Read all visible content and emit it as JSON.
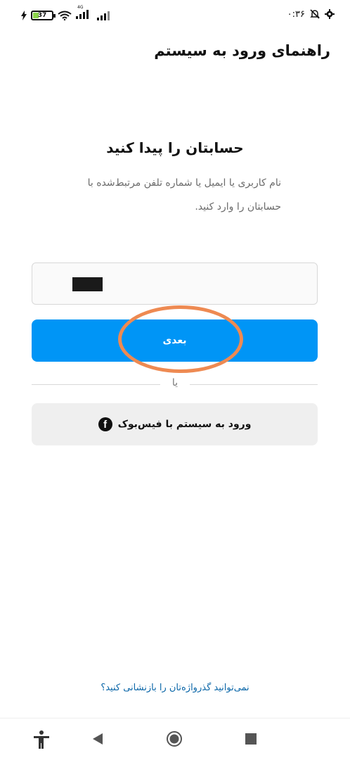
{
  "status_bar": {
    "battery": "37",
    "network": "4G",
    "time": "۰:۳۶"
  },
  "header": {
    "title": "راهنمای ورود به سیستم"
  },
  "main": {
    "heading": "حسابتان را پیدا کنید",
    "subtitle": "نام کاربری یا ایمیل یا شماره تلفن مرتبط‌شده با حسابتان را وارد کنید.",
    "next_label": "بعدی",
    "or_label": "یا",
    "facebook_label": "ورود به سیستم با فیس‌بوک"
  },
  "footer": {
    "forgot_link": "نمی‌توانید گذرواژه‌تان را بازنشانی کنید؟"
  },
  "colors": {
    "primary_button": "#0095f6",
    "highlight_ring": "#ee8a52",
    "link": "#0a66a8"
  },
  "icons": {
    "accessibility": "accessibility-icon",
    "back": "back-icon",
    "home": "home-icon",
    "recents": "recents-icon",
    "facebook": "facebook-icon"
  }
}
